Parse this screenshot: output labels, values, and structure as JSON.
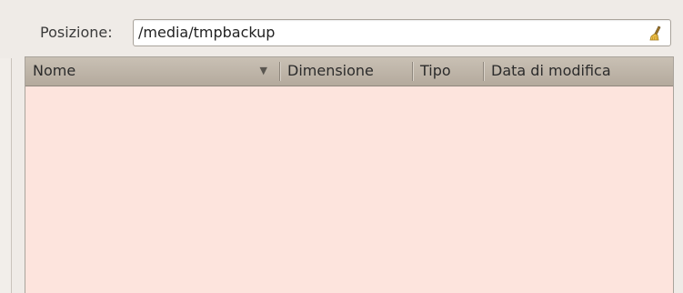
{
  "location": {
    "label": "Posizione:",
    "value": "/media/tmpbackup"
  },
  "file_list": {
    "columns": [
      {
        "label": "Nome",
        "sort": "descending"
      },
      {
        "label": "Dimensione"
      },
      {
        "label": "Tipo"
      },
      {
        "label": "Data di modifica"
      }
    ],
    "rows": []
  },
  "icons": {
    "clear": "broom-clear-icon",
    "sort": "sort-down-arrow-icon"
  },
  "colors": {
    "list_background": "#fde4dd",
    "header_background": "#bdb3a6",
    "window_background": "#efebe7"
  },
  "glyphs": {
    "sort_arrow": "▼"
  }
}
